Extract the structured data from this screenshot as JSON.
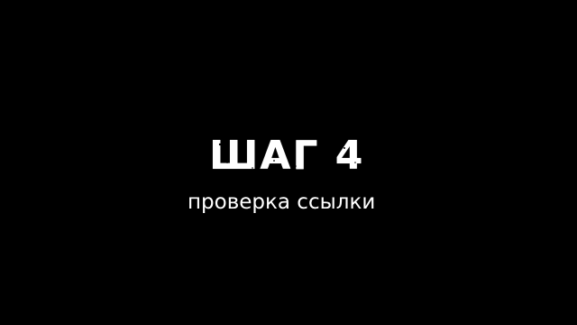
{
  "screen": {
    "background": "#000000",
    "text_color": "#ffffff"
  },
  "step": {
    "title": "ШАГ 4",
    "subtitle": "проверка ссылки"
  }
}
